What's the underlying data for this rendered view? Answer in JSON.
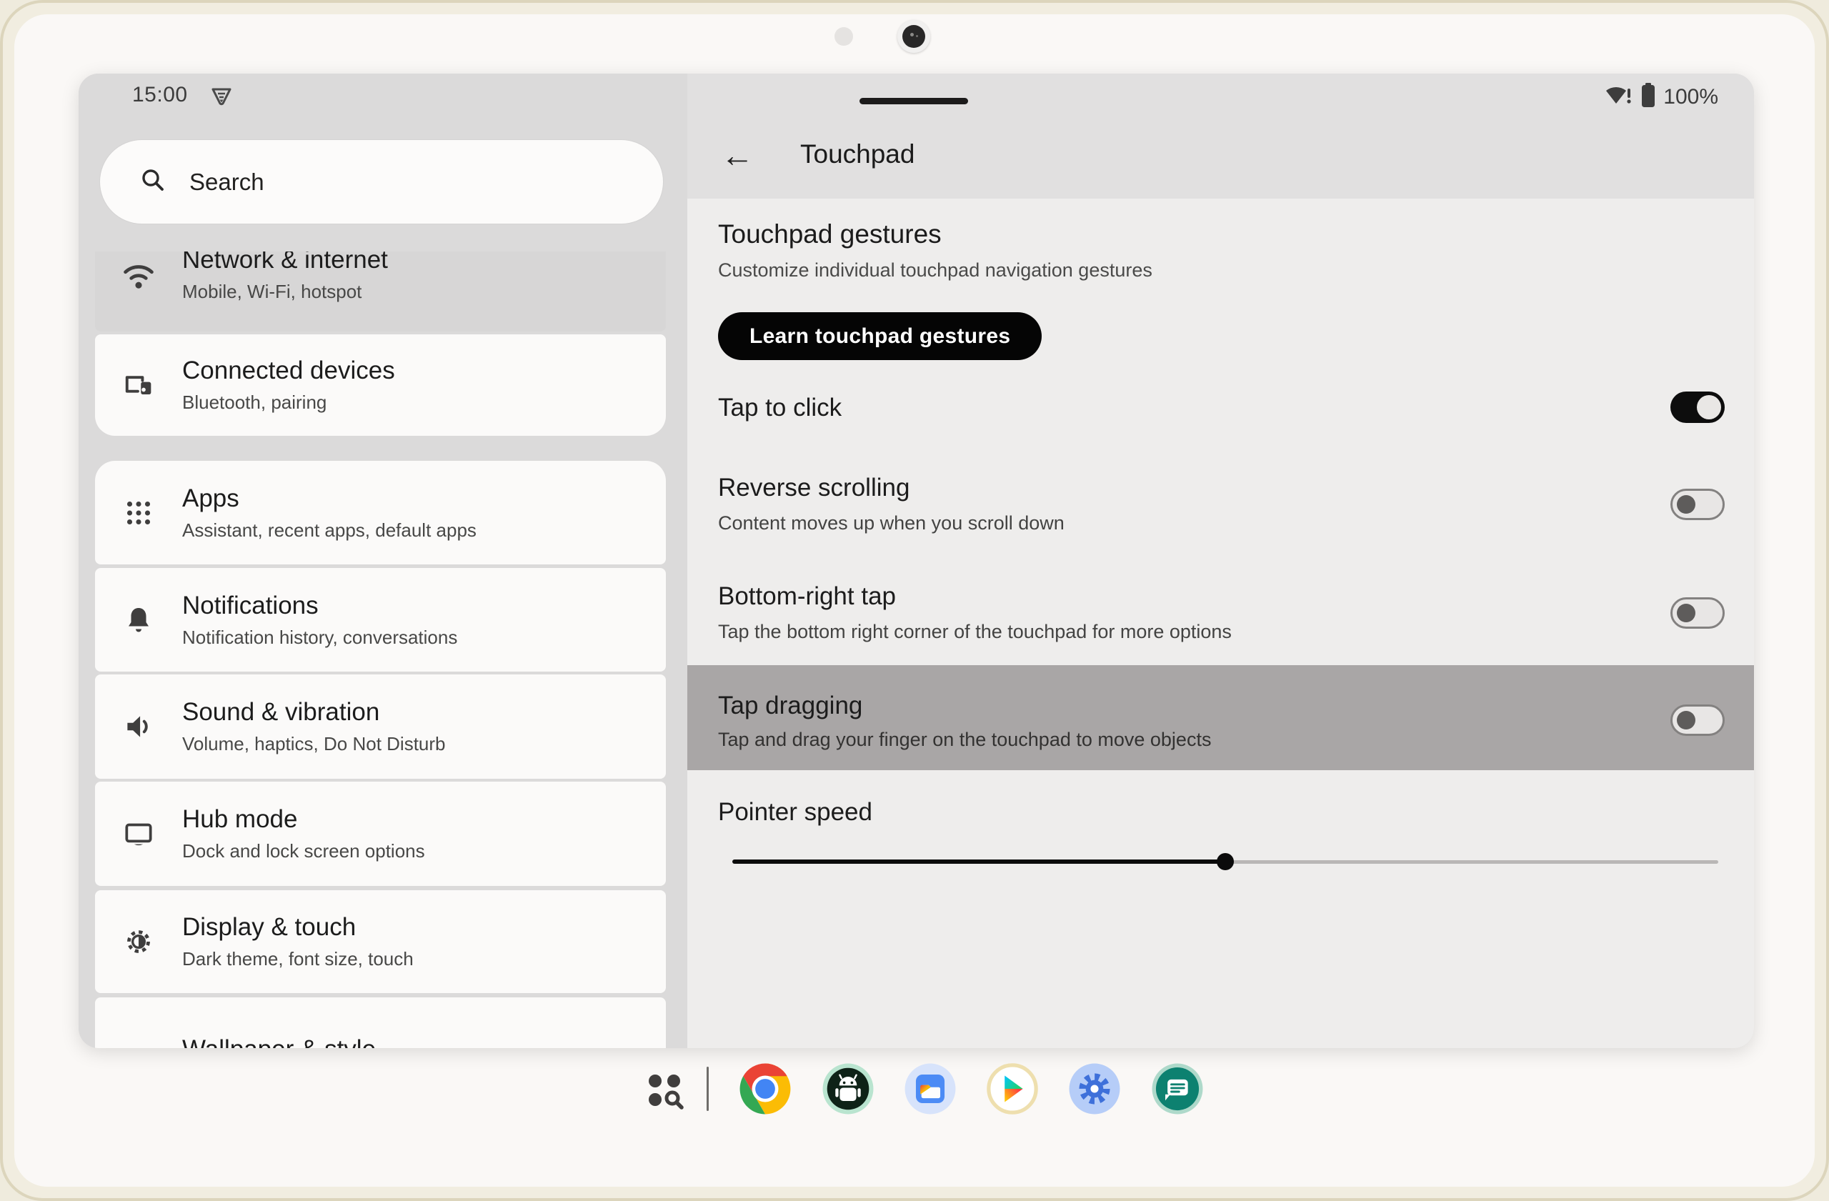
{
  "status_bar": {
    "time": "15:00",
    "battery_pct": "100%",
    "icons": [
      "vpn-shield-icon",
      "wifi-alert-icon",
      "battery-icon"
    ]
  },
  "sidebar": {
    "search_placeholder": "Search",
    "items": [
      {
        "icon": "wifi-icon",
        "label": "Network & internet",
        "sublabel": "Mobile, Wi-Fi, hotspot"
      },
      {
        "icon": "devices-icon",
        "label": "Connected devices",
        "sublabel": "Bluetooth, pairing"
      },
      {
        "icon": "apps-grid-icon",
        "label": "Apps",
        "sublabel": "Assistant, recent apps, default apps"
      },
      {
        "icon": "bell-icon",
        "label": "Notifications",
        "sublabel": "Notification history, conversations"
      },
      {
        "icon": "speaker-icon",
        "label": "Sound & vibration",
        "sublabel": "Volume, haptics, Do Not Disturb"
      },
      {
        "icon": "monitor-icon",
        "label": "Hub mode",
        "sublabel": "Dock and lock screen options"
      },
      {
        "icon": "brightness-icon",
        "label": "Display & touch",
        "sublabel": "Dark theme, font size, touch"
      },
      {
        "icon": "wallpaper-icon",
        "label": "Wallpaper & style",
        "sublabel": ""
      }
    ]
  },
  "detail": {
    "title": "Touchpad",
    "section_title": "Touchpad gestures",
    "section_subtitle": "Customize individual touchpad navigation gestures",
    "learn_button_label": "Learn touchpad gestures",
    "rows": [
      {
        "label": "Tap to click",
        "sublabel": "",
        "state": "on",
        "highlighted": false
      },
      {
        "label": "Reverse scrolling",
        "sublabel": "Content moves up when you scroll down",
        "state": "off",
        "highlighted": false
      },
      {
        "label": "Bottom-right tap",
        "sublabel": "Tap the bottom right corner of the touchpad for more options",
        "state": "off",
        "highlighted": false
      },
      {
        "label": "Tap dragging",
        "sublabel": "Tap and drag your finger on the touchpad to move objects",
        "state": "off",
        "highlighted": true
      }
    ],
    "slider": {
      "label": "Pointer speed",
      "value_pct": 50
    }
  },
  "dock": {
    "icons": [
      "app-drawer-search-icon",
      "chrome-icon",
      "android-icon",
      "files-icon",
      "play-store-icon",
      "settings-gear-icon",
      "messages-icon"
    ]
  },
  "colors": {
    "bezel": "#f1ede0",
    "screen": "#faf8f6",
    "window_bg": "#dbdada",
    "detail_bg": "#eeedec",
    "card_bg": "#fbfaf9",
    "highlight_row": "#a9a6a6",
    "toggle_on": "#0d0d0d",
    "button_bg": "#050505"
  }
}
